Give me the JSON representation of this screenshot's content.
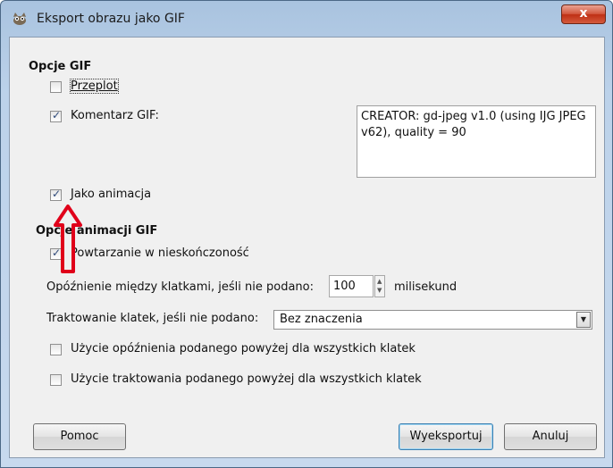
{
  "window": {
    "title": "Eksport obrazu jako GIF",
    "close_label": "x"
  },
  "gif_options": {
    "heading": "Opcje GIF",
    "interlace": {
      "label": "Przeplot",
      "checked": false
    },
    "comment": {
      "label": "Komentarz GIF:",
      "checked": true
    },
    "comment_text": "CREATOR: gd-jpeg v1.0 (using IJG JPEG v62), quality = 90",
    "as_animation": {
      "label": "Jako animacja",
      "checked": true
    }
  },
  "animation_options": {
    "heading": "Opcje animacji GIF",
    "loop": {
      "label": "Powtarzanie w nieskończoność",
      "checked": true
    },
    "delay": {
      "label": "Opóźnienie między klatkami, jeśli nie podano:",
      "value": "100",
      "unit": "milisekund"
    },
    "disposal": {
      "label": "Traktowanie klatek, jeśli nie podano:",
      "selected": "Bez znaczenia"
    },
    "use_delay_all": {
      "label": "Użycie opóźnienia podanego powyżej dla wszystkich klatek",
      "checked": false
    },
    "use_disposal_all": {
      "label": "Użycie traktowania podanego powyżej dla wszystkich klatek",
      "checked": false
    }
  },
  "buttons": {
    "help": "Pomoc",
    "export": "Wyeksportuj",
    "cancel": "Anuluj"
  },
  "colors": {
    "annotation_arrow": "#e0001a"
  }
}
